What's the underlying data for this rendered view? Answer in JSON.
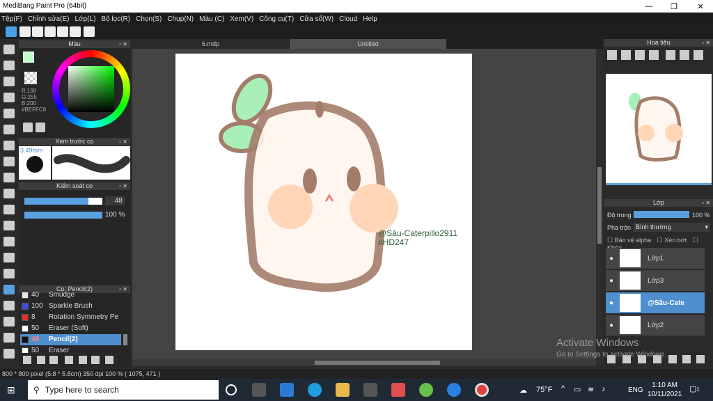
{
  "window": {
    "title": "MediBang Paint Pro (64bit)"
  },
  "menu": [
    "Tệp(F)",
    "Chỉnh sửa(E)",
    "Lớp(L)",
    "Bộ lọc(R)",
    "Chọn(S)",
    "Chụp(N)",
    "Màu (C)",
    "Xem(V)",
    "Công cụ(T)",
    "Cửa sổ(W)",
    "Cloud",
    "Help"
  ],
  "color": {
    "header": "Màu",
    "r": "R:190",
    "g": "G:255",
    "b": "B:200",
    "hex": "#BEFFC8",
    "current": "#BEFFC8"
  },
  "brush_preview": {
    "header": "Xem trước cọ",
    "size": "3.49mm"
  },
  "size_panel": {
    "header": "Kiểm soát cọ",
    "size_value": "48",
    "size_fraction": 0.82,
    "opacity_value": "100 %",
    "opacity_fraction": 1.0
  },
  "brush_list": {
    "header": "Cọ: Pencil(2)",
    "items": [
      {
        "num": "40",
        "name": "Smudge",
        "color": "#e8e8e8"
      },
      {
        "num": "100",
        "name": "Sparkle Brush",
        "color": "#3a4fd8"
      },
      {
        "num": "8",
        "name": "Rotation Symmetry Pe",
        "color": "#e03030"
      },
      {
        "num": "50",
        "name": "Eraser (Soft)",
        "color": "#ffffff"
      },
      {
        "num": "48",
        "name": "Pencil(2)",
        "color": "#111111",
        "selected": true
      },
      {
        "num": "50",
        "name": "Eraser",
        "color": "#ffffff"
      }
    ]
  },
  "tabs": [
    "6.mdp",
    "Untitled"
  ],
  "navigator": {
    "header": "Hoa tiêu"
  },
  "layers": {
    "header": "Lớp",
    "opacity_label": "Độ trong",
    "opacity_value": "100 %",
    "blend_label": "Pha trộn",
    "blend_value": "Bình thường",
    "protect_alpha": "Bảo vệ alpha",
    "clipping": "Xén bớt",
    "lock": "Khóa",
    "items": [
      {
        "name": "Lớp1"
      },
      {
        "name": "Lớp3"
      },
      {
        "name": "@Sâu-Cate",
        "selected": true
      },
      {
        "name": "Lớp2"
      }
    ]
  },
  "canvas": {
    "watermark_line1": "@Sâu-Caterpillo2911",
    "watermark_line2": "#HD247"
  },
  "status": {
    "text": "800 * 800 pixel   (5.8 * 5.8cm)   350 dpi   100 %   ( 1075, 471 )"
  },
  "activate": {
    "line1": "Activate Windows",
    "line2": "Go to Settings to activate Windows."
  },
  "taskbar": {
    "search_placeholder": "Type here to search",
    "weather": "75°F",
    "lang": "ENG",
    "time": "1:10 AM",
    "date": "10/11/2021",
    "notif": "1"
  }
}
